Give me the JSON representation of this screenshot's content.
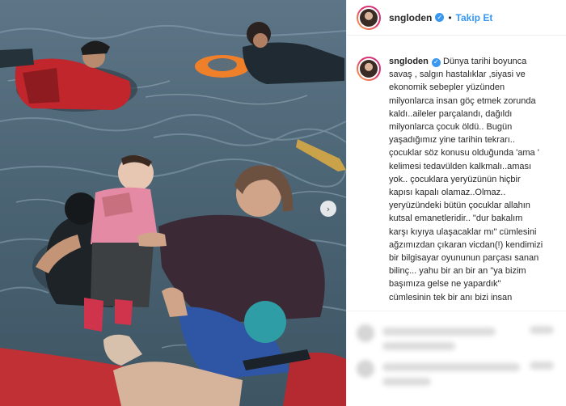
{
  "post": {
    "username": "sngloden",
    "separator": "•",
    "follow_label": "Takip Et",
    "verified_mark": "✓",
    "next_arrow": "›",
    "caption_lines": [
      "savaş , salgın hastalıklar ,siyasi ve",
      "ekonomik sebepler yüzünden",
      "milyonlarca insan göç etmek zorunda",
      "kaldı..aileler parçalandı, dağıldı",
      "milyonlarca çocuk öldü.. Bugün",
      "yaşadığımız yine tarihin tekrarı..",
      "çocuklar söz konusu olduğunda 'ama '",
      "kelimesi tedavülden kalkmalı..aması",
      "yok.. çocuklara yeryüzünün hiçbir",
      "kapısı kapalı olamaz..Olmaz..",
      "yeryüzündeki bütün çocuklar allahın",
      "kutsal emanetleridir.. \"dur bakalım",
      "karşı kıyıya ulaşacaklar mı\" cümlesini",
      "ağzımızdan çıkaran vicdan(!) kendimizi",
      "bir bilgisayar oyununun parçası sanan",
      "bilinç... yahu bir an bir an \"ya bizim",
      "başımıza gelse ne yapardık\"",
      "cümlesinin tek bir anı bizi insan"
    ],
    "caption_first_line": "Dünya tarihi boyunca"
  },
  "icons": {
    "verified": "verified-badge-icon",
    "next": "chevron-right-icon"
  },
  "colors": {
    "link_blue": "#3897f0",
    "text": "#262626",
    "story_ring_start": "#f9b04a",
    "story_ring_end": "#c13584"
  }
}
